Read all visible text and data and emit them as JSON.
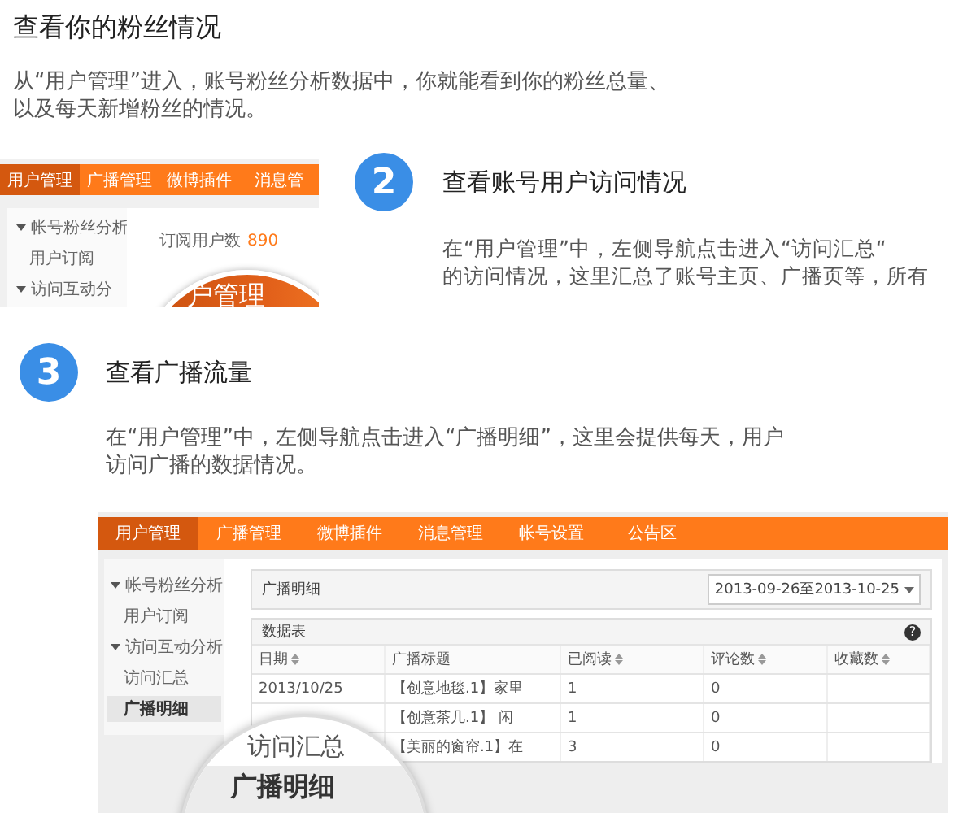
{
  "fans_section": {
    "title": "查看你的粉丝情况",
    "lines": [
      "从“用户管理”进入，账号粉丝分析数据中，你就能看到你的粉丝总量、",
      "以及每天新增粉丝的情况。"
    ]
  },
  "fans_screenshot": {
    "nav_tabs": [
      {
        "label": "用户管理",
        "selected": true
      },
      {
        "label": "广播管理",
        "selected": false
      },
      {
        "label": "微博插件",
        "selected": false
      },
      {
        "label": "消息管",
        "selected": false
      }
    ],
    "sidebar": [
      {
        "label": "帐号粉丝分析",
        "kind": "group",
        "selected": false
      },
      {
        "label": "用户订阅",
        "kind": "item",
        "selected": false
      },
      {
        "label": "访问互动分",
        "kind": "group",
        "selected": false
      }
    ],
    "stat_label": "订阅用户数",
    "stat_value": "890",
    "magnifier": [
      "户管理"
    ]
  },
  "visits_section": {
    "badge": "2",
    "title": "查看账号用户访问情况",
    "lines": [
      "在“用户管理”中，左侧导航点击进入“访问汇总“",
      "的访问情况，这里汇总了账号主页、广播页等，所有"
    ]
  },
  "traffic_section": {
    "badge": "3",
    "title": "查看广播流量",
    "lines": [
      "在“用户管理”中，左侧导航点击进入“广播明细”，这里会提供每天，用户",
      "访问广播的数据情况。"
    ]
  },
  "traffic_screenshot": {
    "nav_tabs": [
      {
        "label": "用户管理",
        "selected": true
      },
      {
        "label": "广播管理",
        "selected": false
      },
      {
        "label": "微博插件",
        "selected": false
      },
      {
        "label": "消息管理",
        "selected": false
      },
      {
        "label": "帐号设置",
        "selected": false
      },
      {
        "label": "公告区",
        "selected": false
      }
    ],
    "sidebar": [
      {
        "label": "帐号粉丝分析",
        "kind": "group",
        "selected": false
      },
      {
        "label": "用户订阅",
        "kind": "item",
        "selected": false
      },
      {
        "label": "访问互动分析",
        "kind": "group",
        "selected": false
      },
      {
        "label": "访问汇总",
        "kind": "item",
        "selected": false
      },
      {
        "label": "广播明细",
        "kind": "item",
        "selected": true
      }
    ],
    "panel_title": "广播明细",
    "date_range": "2013-09-26至2013-10-25",
    "table": {
      "title": "数据表",
      "help": "?",
      "columns": [
        {
          "label": "日期",
          "sortable": true
        },
        {
          "label": "广播标题",
          "sortable": false
        },
        {
          "label": "已阅读",
          "sortable": true
        },
        {
          "label": "评论数",
          "sortable": true
        },
        {
          "label": "收藏数",
          "sortable": true
        }
      ],
      "rows": [
        {
          "date": "2013/10/25",
          "title": "【创意地毯.1】家里",
          "read": "1",
          "comments": "0"
        },
        {
          "title": "【创意茶几.1】 闲",
          "read": "1",
          "comments": "0"
        },
        {
          "title": "【美丽的窗帘.1】在",
          "read": "3",
          "comments": "0"
        }
      ]
    },
    "magnifier": [
      "访问汇总",
      "广播明细"
    ]
  }
}
